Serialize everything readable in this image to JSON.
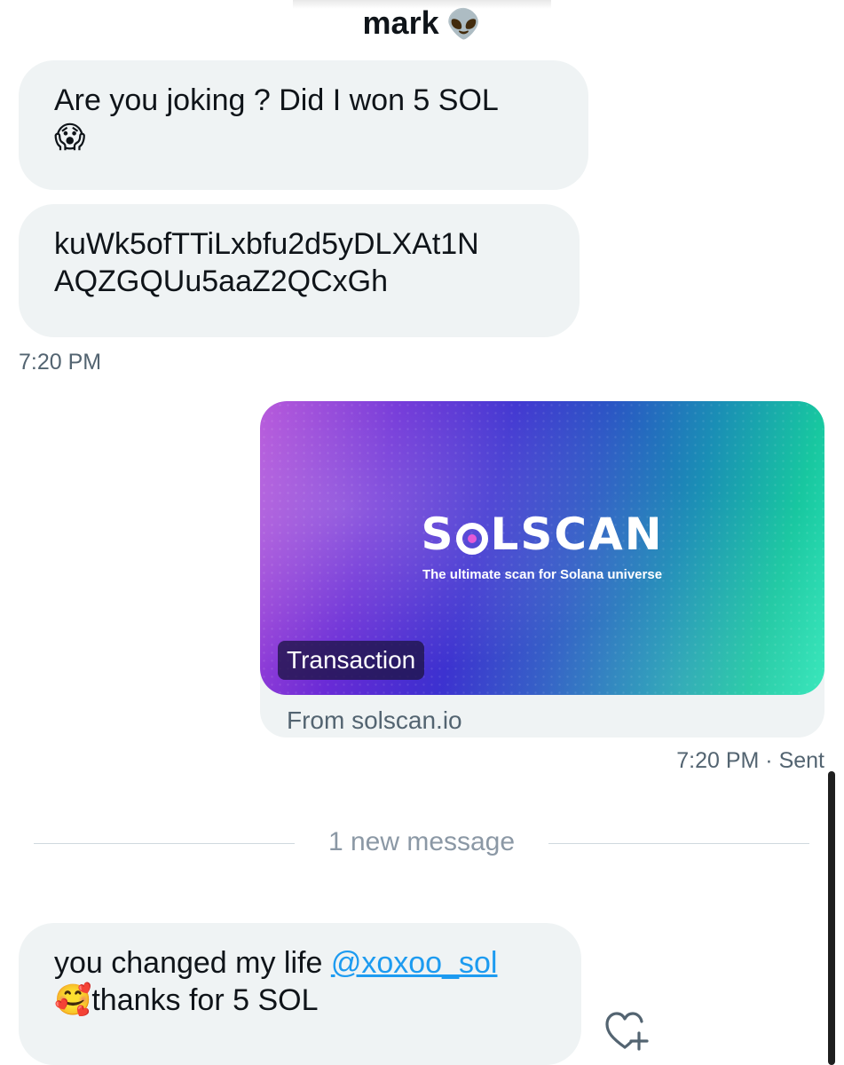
{
  "header": {
    "name": "mark",
    "emoji": "👽"
  },
  "messages": [
    {
      "sender": "other",
      "text": "Are you joking ? Did I won 5 SOL",
      "emoji": "😱"
    },
    {
      "sender": "other",
      "line1": "kuWk5ofTTiLxbfu2d5yDLXAt1N",
      "line2": "AQZGQUu5aaZ2QCxGh"
    }
  ],
  "timestamp_1": "7:20 PM",
  "link_card": {
    "brand_pre": "S",
    "brand_post": "LSCAN",
    "tagline": "The ultimate scan for Solana universe",
    "badge": "Transaction",
    "source": "From solscan.io"
  },
  "timestamp_2": "7:20 PM · Sent",
  "divider": {
    "text": "1 new message"
  },
  "last_message": {
    "text_before": "you changed my life ",
    "mention": "@xoxoo_sol",
    "emoji": "🥰",
    "text_after": "thanks for 5 SOL"
  },
  "icons": {
    "reaction": "heart-plus-icon"
  },
  "colors": {
    "bubble": "#eff3f4",
    "mention": "#1d9bf0",
    "muted": "#536471"
  }
}
